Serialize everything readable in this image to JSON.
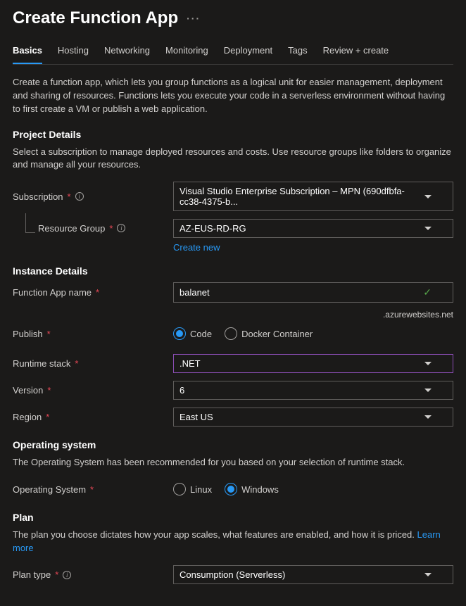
{
  "header": {
    "title": "Create Function App"
  },
  "tabs": [
    {
      "label": "Basics",
      "active": true
    },
    {
      "label": "Hosting",
      "active": false
    },
    {
      "label": "Networking",
      "active": false
    },
    {
      "label": "Monitoring",
      "active": false
    },
    {
      "label": "Deployment",
      "active": false
    },
    {
      "label": "Tags",
      "active": false
    },
    {
      "label": "Review + create",
      "active": false
    }
  ],
  "intro": "Create a function app, which lets you group functions as a logical unit for easier management, deployment and sharing of resources. Functions lets you execute your code in a serverless environment without having to first create a VM or publish a web application.",
  "project": {
    "title": "Project Details",
    "desc": "Select a subscription to manage deployed resources and costs. Use resource groups like folders to organize and manage all your resources.",
    "subscription_label": "Subscription",
    "subscription_value": "Visual Studio Enterprise Subscription – MPN (690dfbfa-cc38-4375-b...",
    "resource_group_label": "Resource Group",
    "resource_group_value": "AZ-EUS-RD-RG",
    "create_new": "Create new"
  },
  "instance": {
    "title": "Instance Details",
    "name_label": "Function App name",
    "name_value": "balanet",
    "name_suffix": ".azurewebsites.net",
    "publish_label": "Publish",
    "publish_options": [
      "Code",
      "Docker Container"
    ],
    "publish_selected": "Code",
    "runtime_label": "Runtime stack",
    "runtime_value": ".NET",
    "version_label": "Version",
    "version_value": "6",
    "region_label": "Region",
    "region_value": "East US"
  },
  "os": {
    "title": "Operating system",
    "desc": "The Operating System has been recommended for you based on your selection of runtime stack.",
    "label": "Operating System",
    "options": [
      "Linux",
      "Windows"
    ],
    "selected": "Windows"
  },
  "plan": {
    "title": "Plan",
    "desc": "The plan you choose dictates how your app scales, what features are enabled, and how it is priced.",
    "learn_more": "Learn more",
    "type_label": "Plan type",
    "type_value": "Consumption (Serverless)"
  }
}
